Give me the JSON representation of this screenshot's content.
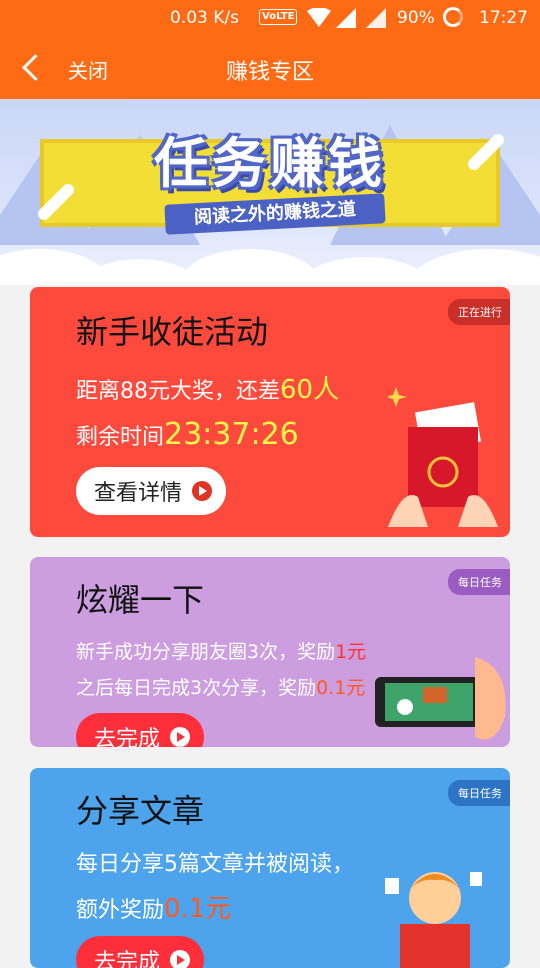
{
  "status_bar": {
    "speed": "0.03 K/s",
    "volte": "VoLTE",
    "battery": "90%",
    "time": "17:27"
  },
  "header": {
    "back_icon": "chevron-left-icon",
    "close_label": "关闭",
    "title": "赚钱专区"
  },
  "banner": {
    "title": "任务赚钱",
    "subtitle": "阅读之外的赚钱之道"
  },
  "cards": [
    {
      "badge": "正在进行",
      "title": "新手收徒活动",
      "line1_prefix": "距离88元大奖，还差",
      "line1_highlight": "60人",
      "line2_prefix": "剩余时间",
      "line2_highlight": "23:37:26",
      "button": "查看详情",
      "color": "#fe4a3d"
    },
    {
      "badge": "每日任务",
      "title": "炫耀一下",
      "line1_prefix": "新手成功分享朋友圈3次，奖励",
      "line1_highlight": "1元",
      "line2_prefix": "之后每日完成3次分享，奖励",
      "line2_highlight": "0.1元",
      "button": "去完成",
      "color": "#cc9ddf"
    },
    {
      "badge": "每日任务",
      "title": "分享文章",
      "line1_prefix": "每日分享5篇文章并被阅读，",
      "line2_prefix": "额外奖励",
      "line2_highlight": "0.1元",
      "button": "去完成",
      "color": "#4da4ec"
    }
  ]
}
